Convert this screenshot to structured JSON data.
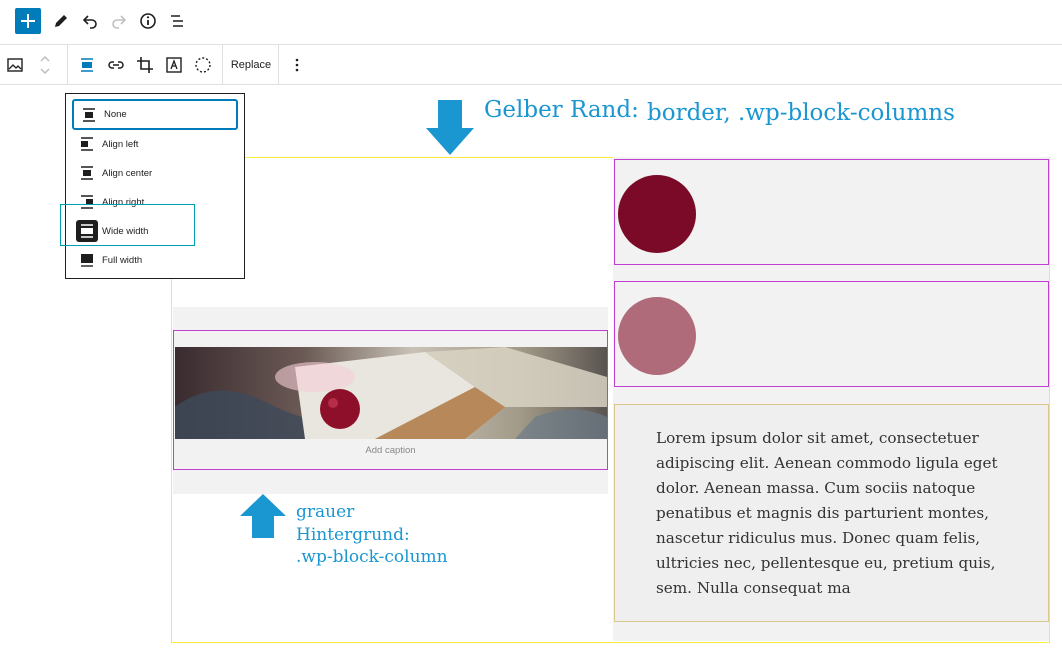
{
  "top_toolbar": {
    "icons": [
      "plus-icon",
      "pencil-icon",
      "undo-icon",
      "redo-icon",
      "info-icon",
      "list-view-icon"
    ]
  },
  "block_toolbar": {
    "icons": [
      "image-icon",
      "move-arrows-icon",
      "align-icon",
      "link-icon",
      "crop-icon",
      "text-overlay-icon",
      "duotone-icon",
      "more-options-icon"
    ],
    "replace_label": "Replace"
  },
  "align_menu": {
    "items": [
      {
        "label": "None",
        "selected": true
      },
      {
        "label": "Align left"
      },
      {
        "label": "Align center"
      },
      {
        "label": "Align right"
      },
      {
        "label": "Wide width"
      },
      {
        "label": "Full width"
      }
    ]
  },
  "editor": {
    "image_caption_placeholder": "Add caption",
    "circle_colors": [
      "#7a0a28",
      "#b06b7b"
    ],
    "paragraph": "Lorem ipsum dolor sit amet, consectetuer adipiscing elit. Aenean commodo ligula eget dolor. Aenean massa. Cum sociis natoque penatibus et magnis dis parturient montes, nascetur ridiculus mus. Donec quam felis, ultricies nec, pellentesque eu, pretium quis, sem. Nulla consequat ma"
  },
  "annotations": {
    "yellow_border_label": "Gelber Rand:",
    "yellow_border_class": "border, .wp-block-columns",
    "grey_bg_line1": "grauer",
    "grey_bg_line2": "Hintergrund:",
    "grey_bg_line3": ".wp-block-column"
  },
  "colors": {
    "accent": "#007cba",
    "annotation": "#1a96d1",
    "yellow_border": "#ffeb3b",
    "purple_border": "#c03fd0"
  }
}
